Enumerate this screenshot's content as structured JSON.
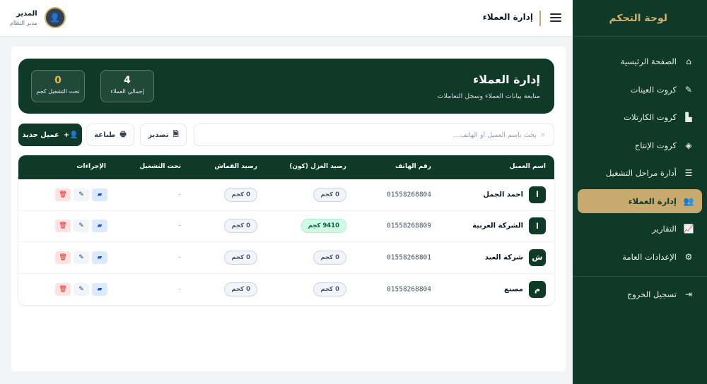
{
  "sidebar": {
    "title": "لوحة التحكم",
    "items": [
      {
        "label": "الصفحة الرئيسية",
        "icon": "home-icon",
        "glyph": "⌂"
      },
      {
        "label": "كروت العينات",
        "icon": "pen-icon",
        "glyph": "✎"
      },
      {
        "label": "كروت الكارتلات",
        "icon": "building-icon",
        "glyph": "▙"
      },
      {
        "label": "كروت الإنتاج",
        "icon": "layers-icon",
        "glyph": "◈"
      },
      {
        "label": "أدارة مراحل التشغيل",
        "icon": "list-check-icon",
        "glyph": "☰"
      },
      {
        "label": "إدارة العملاء",
        "icon": "users-icon",
        "glyph": "👥"
      },
      {
        "label": "التقارير",
        "icon": "chart-icon",
        "glyph": "📈"
      },
      {
        "label": "الإعدادات العامة",
        "icon": "gear-icon",
        "glyph": "⚙"
      }
    ],
    "active_index": 5,
    "logout": {
      "label": "تسجيل الخروج",
      "icon": "logout-icon",
      "glyph": "⇥"
    }
  },
  "topbar": {
    "title": "إدارة العملاء",
    "user": {
      "name": "المدير",
      "role": "مدير النظام"
    }
  },
  "hero": {
    "title": "إدارة العملاء",
    "subtitle": "متابعة بيانات العملاء وسجل التعاملات",
    "stats": [
      {
        "value": "4",
        "label": "إجمالي العملاء"
      },
      {
        "value": "0",
        "label": "تحت التشغيل كجم"
      }
    ]
  },
  "toolbar": {
    "search_placeholder": "بحث باسم العميل أو الهاتف...",
    "export_label": "تصدير",
    "print_label": "طباعة",
    "new_client_label": "عميل جديد"
  },
  "table": {
    "headers": [
      "اسم العميل",
      "رقم الهاتف",
      "رصيد الغزل (كون)",
      "رصيد القماش",
      "تحت التشغيل",
      "الإجراءات"
    ],
    "rows": [
      {
        "initial": "ا",
        "name": "احمد الجمل",
        "phone": "01558268804",
        "yarn": "0 كجم",
        "fabric": "0 كجم",
        "running": "-"
      },
      {
        "initial": "ا",
        "name": "الشركة العربية",
        "phone": "01558268809",
        "yarn": "9410 كجم",
        "fabric": "0 كجم",
        "running": "-"
      },
      {
        "initial": "ش",
        "name": "شركة العبد",
        "phone": "01558268801",
        "yarn": "0 كجم",
        "fabric": "0 كجم",
        "running": "-"
      },
      {
        "initial": "م",
        "name": "مصنع",
        "phone": "01558268804",
        "yarn": "0 كجم",
        "fabric": "0 كجم",
        "running": "-"
      }
    ]
  },
  "colors": {
    "brand": "#0f3a2a",
    "accent": "#c8a96e"
  }
}
